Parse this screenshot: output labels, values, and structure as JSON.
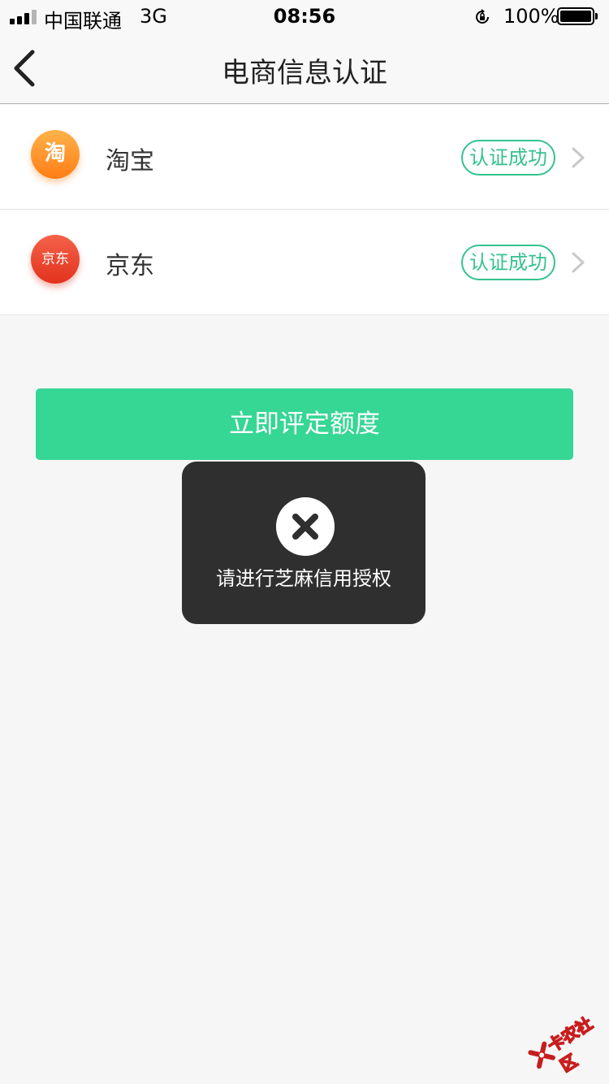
{
  "status_bar": {
    "carrier": "中国联通",
    "network": "3G",
    "time": "08:56",
    "battery": "100%"
  },
  "nav": {
    "title": "电商信息认证",
    "back_icon": "chevron-left-icon"
  },
  "platforms": [
    {
      "name": "淘宝",
      "logo_text": "淘",
      "status": "认证成功"
    },
    {
      "name": "京东",
      "logo_text": "京东",
      "status": "认证成功"
    }
  ],
  "primary_button": "立即评定额度",
  "toast": {
    "icon": "close-circle-icon",
    "message": "请进行芝麻信用授权"
  },
  "watermark": "卡农社区",
  "colors": {
    "accent": "#36d694",
    "status_green": "#35c28e",
    "taobao_orange": "#ff8d26",
    "jd_red": "#e8412b",
    "toast_bg": "#2f2f2f"
  }
}
